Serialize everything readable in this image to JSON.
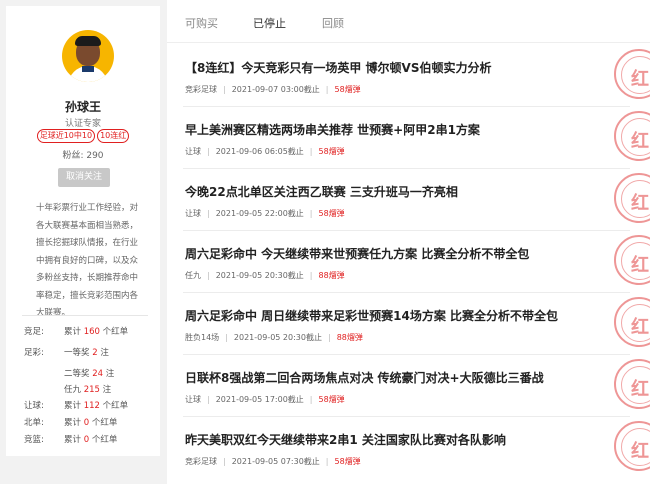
{
  "profile": {
    "name": "孙球王",
    "role": "认证专家",
    "badges": [
      "足球近10中10",
      "10连红"
    ],
    "fans": "粉丝:  290",
    "follow_label": "取消关注",
    "bio": "十年彩票行业工作经验，对各大联赛基本面相当熟悉，擅长挖掘球队情报，在行业中拥有良好的口碑，以及众多粉丝支持，长期推荐命中率稳定，擅长竞彩范围内各大联赛。"
  },
  "stats": [
    {
      "cat": "竞足:",
      "pre": "累计",
      "num": "160",
      "post": "个红单"
    },
    {
      "cat": "足彩:",
      "pre": "一等奖",
      "num": "2",
      "post": "注"
    },
    {
      "cat": "",
      "pre": "二等奖",
      "num": "24",
      "post": "注"
    },
    {
      "cat": "",
      "pre": "任九",
      "num": "215",
      "post": "注"
    },
    {
      "cat": "让球:",
      "pre": "累计",
      "num": "112",
      "post": "个红单"
    },
    {
      "cat": "北单:",
      "pre": "累计",
      "num": "0",
      "post": "个红单"
    },
    {
      "cat": "竞篮:",
      "pre": "累计",
      "num": "0",
      "post": "个红单"
    }
  ],
  "tabs": [
    "可购买",
    "已停止",
    "回顾"
  ],
  "stamp_char": "红",
  "articles": [
    {
      "title": "【8连红】今天竞彩只有一场英甲 博尔顿VS伯顿实力分析",
      "cat": "竞彩足球",
      "time": "2021-09-07 03:00截止",
      "hot": "58熘弹"
    },
    {
      "title": "早上美洲赛区精选两场串关推荐 世预赛+阿甲2串1方案",
      "cat": "让球",
      "time": "2021-09-06 06:05截止",
      "hot": "58熘弹"
    },
    {
      "title": "今晚22点北单区关注西乙联赛 三支升班马一齐亮相",
      "cat": "让球",
      "time": "2021-09-05 22:00截止",
      "hot": "58熘弹"
    },
    {
      "title": "周六足彩命中 今天继续带来世预赛任九方案 比赛全分析不带全包",
      "cat": "任九",
      "time": "2021-09-05 20:30截止",
      "hot": "88熘弹"
    },
    {
      "title": "周六足彩命中 周日继续带来足彩世预赛14场方案 比赛全分析不带全包",
      "cat": "胜负14场",
      "time": "2021-09-05 20:30截止",
      "hot": "88熘弹"
    },
    {
      "title": "日联杯8强战第二回合两场焦点对决 传统豪门对决+大阪德比三番战",
      "cat": "让球",
      "time": "2021-09-05 17:00截止",
      "hot": "58熘弹"
    },
    {
      "title": "昨天美职双红今天继续带来2串1 关注国家队比赛对各队影响",
      "cat": "竞彩足球",
      "time": "2021-09-05 07:30截止",
      "hot": "58熘弹"
    }
  ]
}
